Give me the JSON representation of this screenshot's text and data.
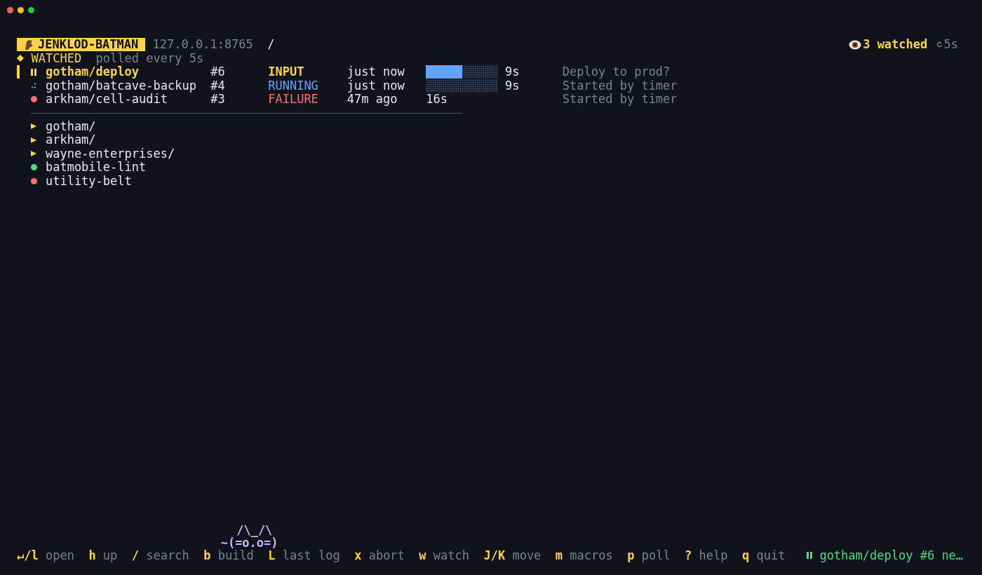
{
  "header": {
    "app": "JENKLOD-BATMAN",
    "host": "127.0.0.1:8765",
    "path": "/",
    "watched": "3 watched",
    "poll": "5s"
  },
  "section": {
    "label": "WATCHED",
    "note": "polled every 5s"
  },
  "jobs": [
    {
      "name": "gotham/deploy",
      "number": "#6",
      "status": "INPUT",
      "kind": "input",
      "when": "just now",
      "level": 0.5,
      "duration": "9s",
      "description": "Deploy to prod?",
      "selected": true
    },
    {
      "name": "gotham/batcave-backup",
      "number": "#4",
      "status": "RUNNING",
      "kind": "running",
      "when": "just now",
      "indeterminate": true,
      "duration": "9s",
      "description": "Started by timer",
      "selected": false
    },
    {
      "name": "arkham/cell-audit",
      "number": "#3",
      "status": "FAILURE",
      "kind": "failure",
      "when": "47m ago",
      "duration": "16s",
      "description": "Started by timer",
      "selected": false
    }
  ],
  "tree": [
    {
      "name": "gotham/",
      "kind": "folder"
    },
    {
      "name": "arkham/",
      "kind": "folder"
    },
    {
      "name": "wayne-enterprises/",
      "kind": "folder"
    },
    {
      "name": "batmobile-lint",
      "kind": "job",
      "color": "#4ade80"
    },
    {
      "name": "utility-belt",
      "kind": "job",
      "color": "#f87171"
    }
  ],
  "mascot": [
    "/\\_/\\",
    "~(=o.o=)"
  ],
  "keys": [
    {
      "key": "↵/l",
      "label": "open"
    },
    {
      "key": "h",
      "label": "up"
    },
    {
      "key": "/",
      "label": "search"
    },
    {
      "key": "b",
      "label": "build"
    },
    {
      "key": "L",
      "label": "last log"
    },
    {
      "key": "x",
      "label": "abort"
    },
    {
      "key": "w",
      "label": "watch"
    },
    {
      "key": "J/K",
      "label": "move"
    },
    {
      "key": "m",
      "label": "macros"
    },
    {
      "key": "p",
      "label": "poll"
    },
    {
      "key": "?",
      "label": "help"
    },
    {
      "key": "q",
      "label": "quit"
    }
  ],
  "status_message": "gotham/deploy #6 ne…"
}
